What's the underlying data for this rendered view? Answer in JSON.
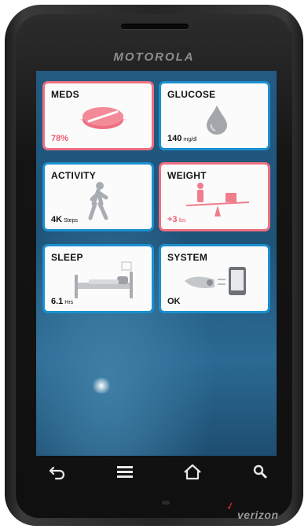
{
  "device": {
    "brand": "MOTOROLA",
    "carrier": "verizon"
  },
  "tiles": [
    {
      "title": "MEDS",
      "value": "78%",
      "unit": "",
      "status": "alert",
      "icon": "pill-icon"
    },
    {
      "title": "GLUCOSE",
      "value": "140",
      "unit": "mg/dl",
      "status": "normal",
      "icon": "drop-icon"
    },
    {
      "title": "ACTIVITY",
      "value": "4K",
      "unit": "Steps",
      "status": "normal",
      "icon": "walking-person-icon"
    },
    {
      "title": "WEIGHT",
      "value": "+3",
      "unit": "lbs",
      "status": "alert",
      "icon": "scale-icon"
    },
    {
      "title": "SLEEP",
      "value": "6.1",
      "unit": "Hrs",
      "status": "normal",
      "icon": "bed-icon"
    },
    {
      "title": "SYSTEM",
      "value": "OK",
      "unit": "",
      "status": "normal",
      "icon": "device-icon"
    }
  ],
  "navbar": [
    {
      "name": "back-icon"
    },
    {
      "name": "menu-icon"
    },
    {
      "name": "home-icon"
    },
    {
      "name": "search-icon"
    }
  ],
  "colors": {
    "normal_border": "#1a8fcf",
    "alert_border": "#ec6f80",
    "alert_text": "#ec5a72"
  }
}
